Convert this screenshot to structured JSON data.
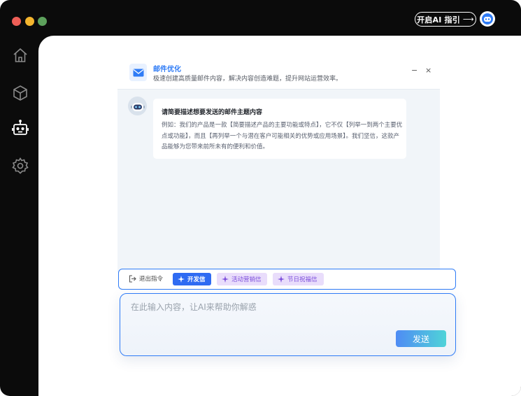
{
  "topbar": {
    "guide_label": "开启AI 指引",
    "guide_arrow": "⟶"
  },
  "sidebar": {
    "items": [
      {
        "icon": "home-icon"
      },
      {
        "icon": "cube-icon"
      },
      {
        "icon": "robot-icon"
      },
      {
        "icon": "gear-icon"
      }
    ]
  },
  "panel": {
    "title": "邮件优化",
    "description": "极速创建高质量邮件内容，解决内容创造难题，提升网站运营效率。",
    "minimize": "−",
    "close": "×"
  },
  "message": {
    "title": "请简要描述想要发送的邮件主题内容",
    "body": "例如：我们的产品是一款【简要描述产品的主要功能或特点】，它不仅【列举一到两个主要优点或功能】，而且【再列举一个与潜在客户可能相关的优势或应用场景】。我们坚信，这款产品能够为您带来前所未有的便利和价值。"
  },
  "commands": {
    "exit_label": "退出指令",
    "chips": [
      "开发信",
      "活动营销信",
      "节日祝福信"
    ]
  },
  "composer": {
    "placeholder": "在此输入内容，让AI来帮助你解惑",
    "send_label": "发送"
  },
  "colors": {
    "accent": "#2f7cf6",
    "chip_active": "#2f6bf2",
    "chip_soft": "#e9ddfb",
    "sidebar_bg": "#0b0b0b"
  }
}
